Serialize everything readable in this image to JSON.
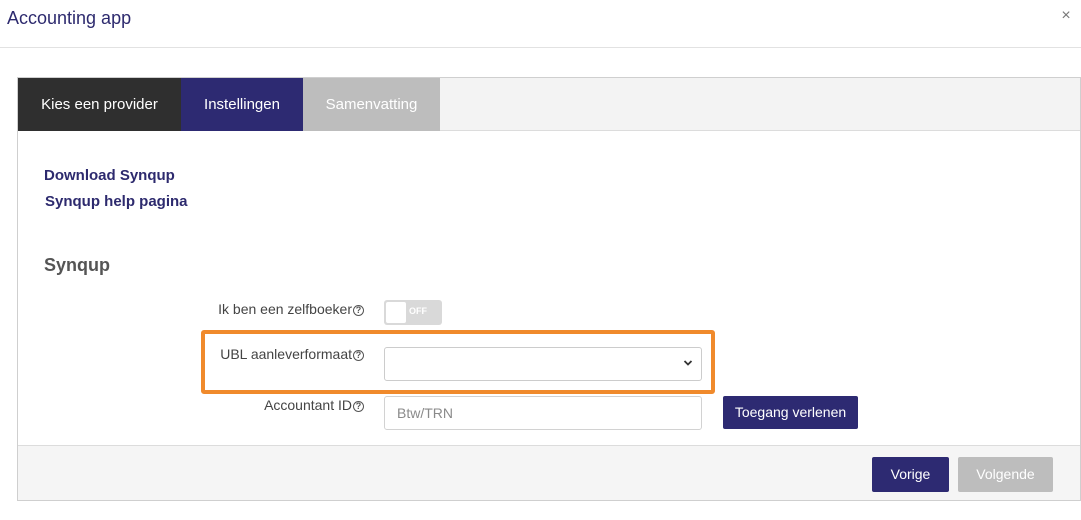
{
  "window": {
    "title": "Accounting app",
    "close_label": "×"
  },
  "tabs": [
    {
      "label": "Kies een provider",
      "color": "#2f2f2f"
    },
    {
      "label": "Instellingen",
      "color": "#2d2a72",
      "active": true
    },
    {
      "label": "Samenvatting",
      "color": "#bdbdbd"
    }
  ],
  "links": {
    "download": "Download Synqup",
    "help": "Synqup help pagina"
  },
  "section": {
    "title": "Synqup"
  },
  "fields": {
    "self_bookkeeper": {
      "label": "Ik ben een zelfboeker",
      "toggle_text": "OFF",
      "toggle_state": false
    },
    "ubl_format": {
      "label": "UBL aanleverformaat",
      "selected_value": ""
    },
    "accountant_id": {
      "label": "Accountant ID",
      "placeholder": "Btw/TRN",
      "value": ""
    }
  },
  "help_glyph": "?",
  "buttons": {
    "grant": "Toegang verlenen",
    "prev": "Vorige",
    "next": "Volgende"
  },
  "colors": {
    "brand": "#2d2a72",
    "highlight": "#f08a2c",
    "disabled": "#bdbdbd"
  }
}
